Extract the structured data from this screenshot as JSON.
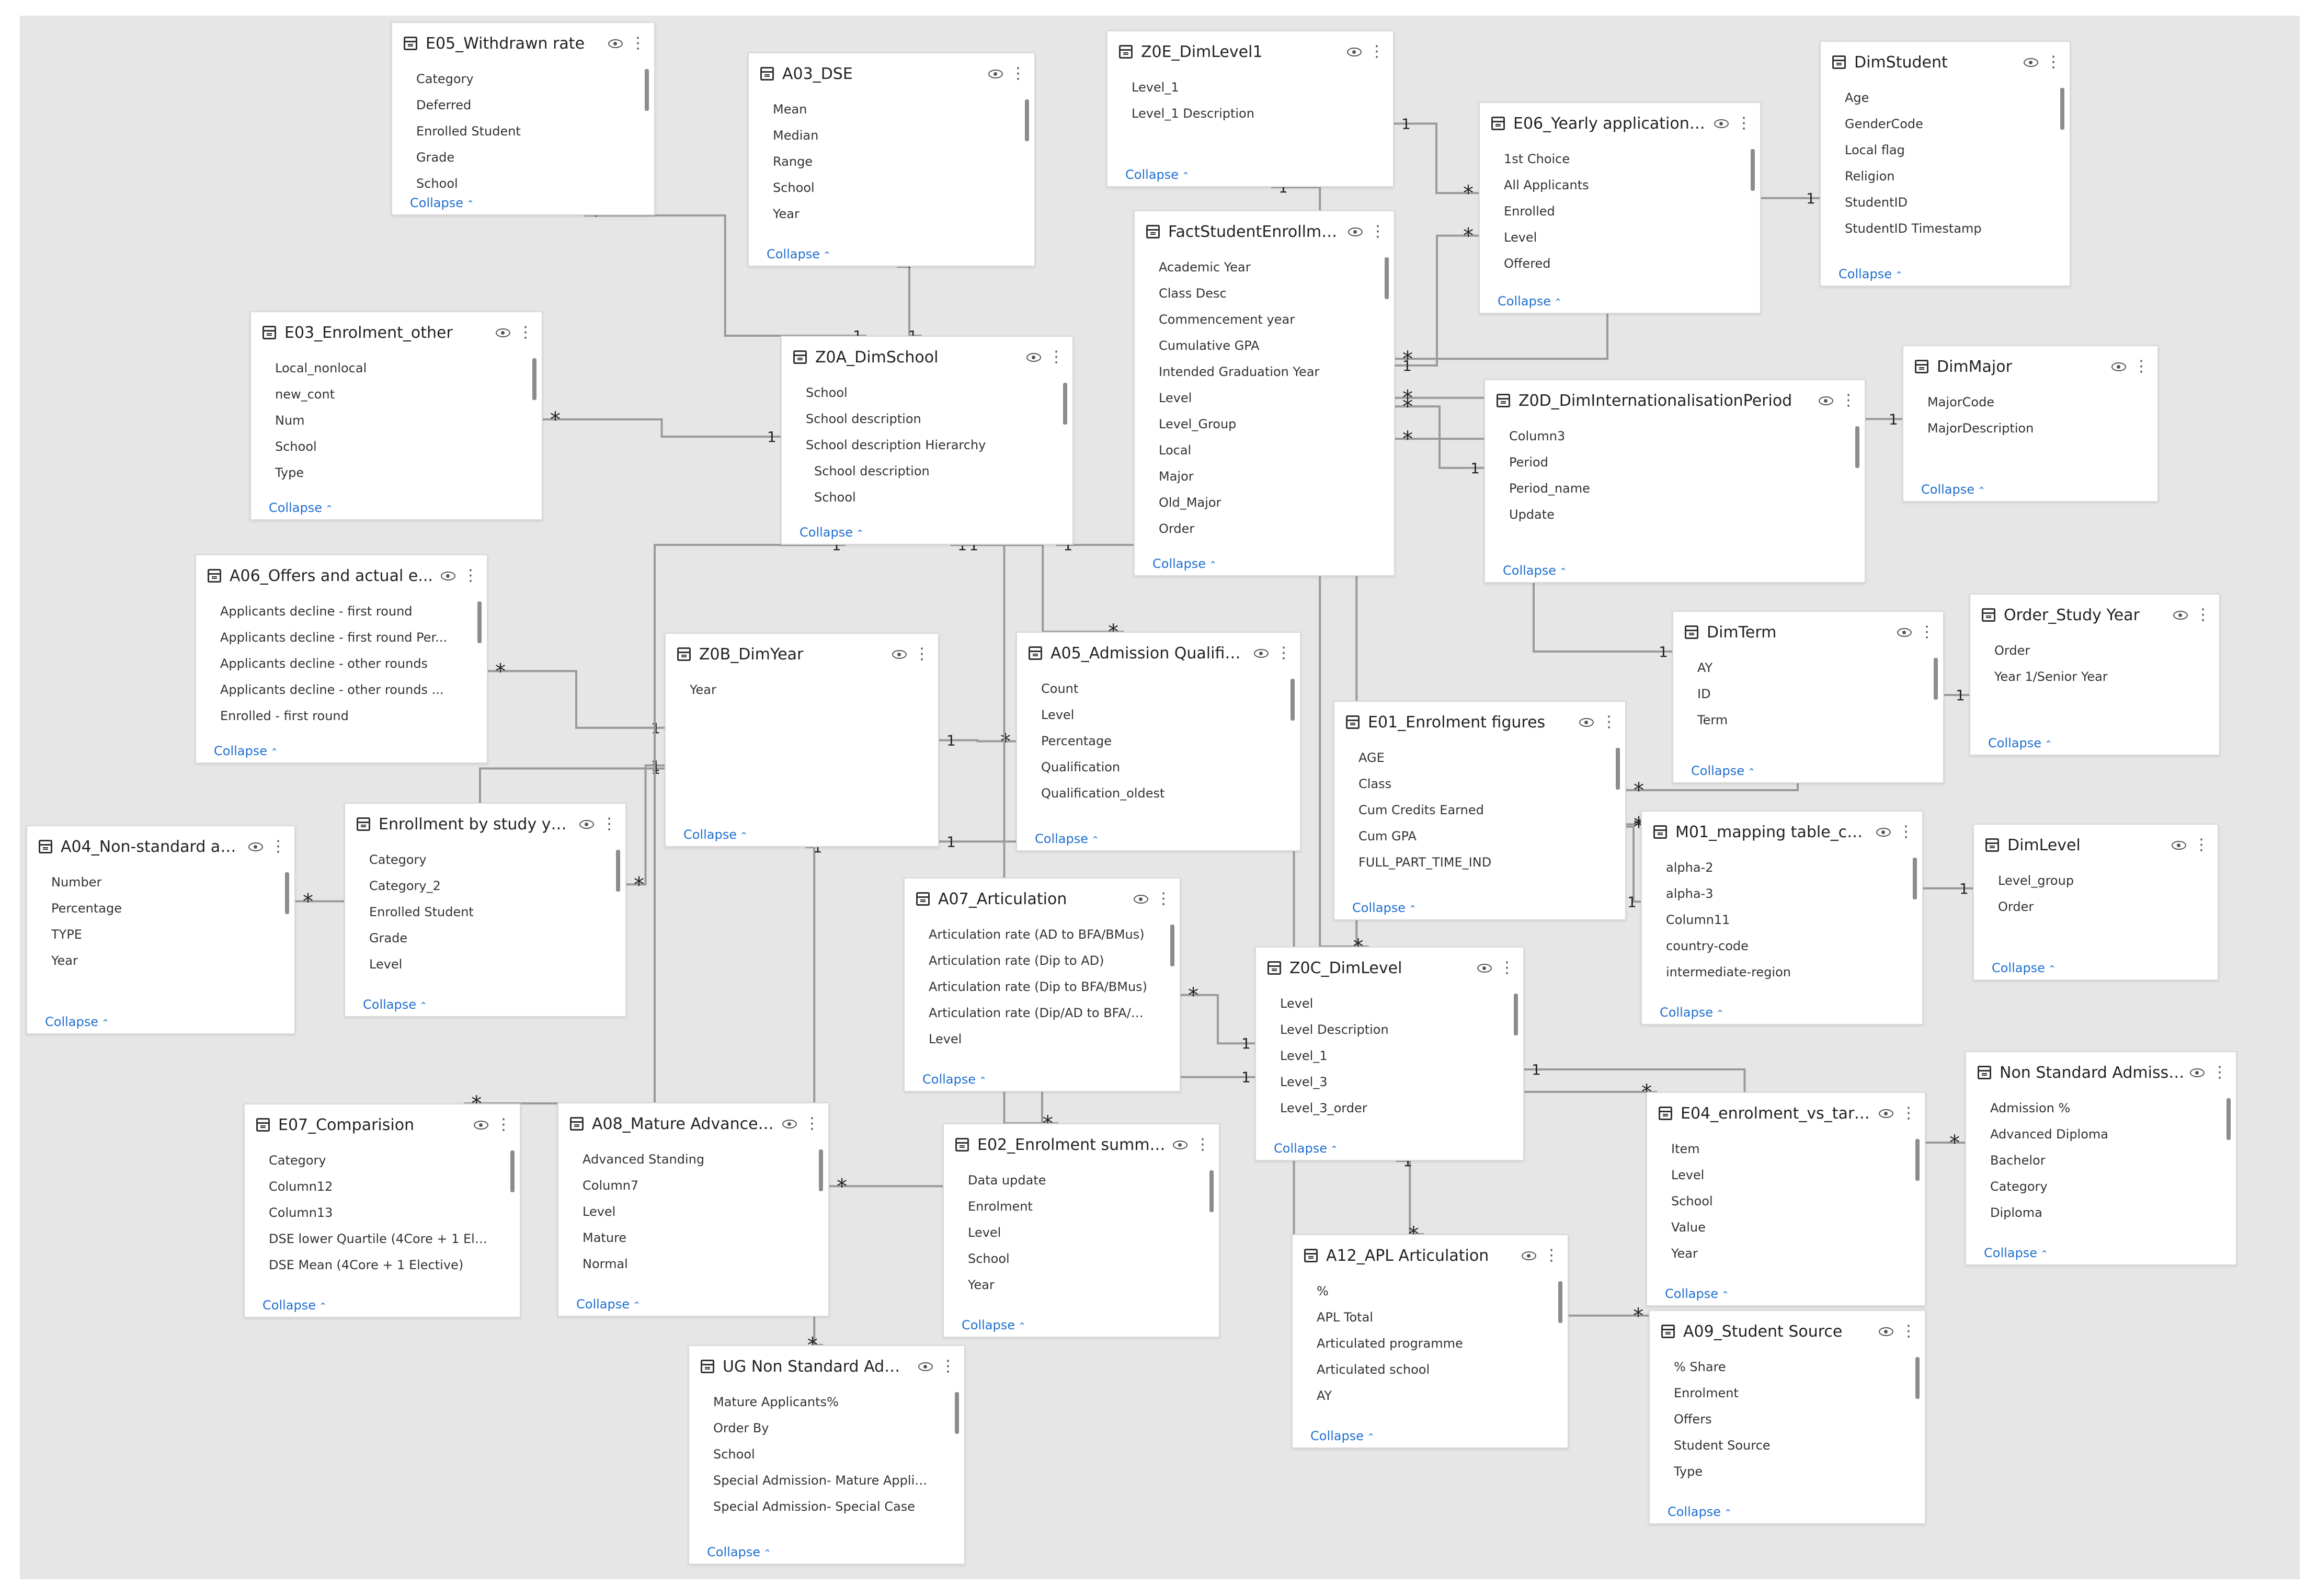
{
  "diagram": {
    "collapse_label": "Collapse",
    "many": "*",
    "one": "1",
    "tables": [
      {
        "id": "e05",
        "title": "E05_Withdrawn rate",
        "fields": [
          {
            "label": "Category",
            "icon": ""
          },
          {
            "label": "Deferred",
            "icon": "sigma"
          },
          {
            "label": "Enrolled Student",
            "icon": "sigma"
          },
          {
            "label": "Grade",
            "icon": ""
          },
          {
            "label": "School",
            "icon": ""
          }
        ]
      },
      {
        "id": "a03",
        "title": "A03_DSE",
        "fields": [
          {
            "label": "Mean",
            "icon": "sigma"
          },
          {
            "label": "Median",
            "icon": ""
          },
          {
            "label": "Range",
            "icon": ""
          },
          {
            "label": "School",
            "icon": ""
          },
          {
            "label": "Year",
            "icon": ""
          }
        ]
      },
      {
        "id": "z0e",
        "title": "Z0E_DimLevel1",
        "fields": [
          {
            "label": "Level_1",
            "icon": ""
          },
          {
            "label": "Level_1 Description",
            "icon": ""
          }
        ]
      },
      {
        "id": "e06",
        "title": "E06_Yearly applications ...",
        "fields": [
          {
            "label": "1st Choice",
            "icon": "sigma"
          },
          {
            "label": "All Applicants",
            "icon": "sigma"
          },
          {
            "label": "Enrolled",
            "icon": "sigma"
          },
          {
            "label": "Level",
            "icon": ""
          },
          {
            "label": "Offered",
            "icon": "sigma"
          }
        ]
      },
      {
        "id": "dimstudent",
        "title": "DimStudent",
        "fields": [
          {
            "label": "Age",
            "icon": "sigma"
          },
          {
            "label": "GenderCode",
            "icon": ""
          },
          {
            "label": "Local flag",
            "icon": ""
          },
          {
            "label": "Religion",
            "icon": ""
          },
          {
            "label": "StudentID",
            "icon": ""
          },
          {
            "label": "StudentID Timestamp",
            "icon": "calendar"
          }
        ]
      },
      {
        "id": "fact",
        "title": "FactStudentEnrollment",
        "fields": [
          {
            "label": "Academic Year",
            "icon": "calendar"
          },
          {
            "label": "Class Desc",
            "icon": ""
          },
          {
            "label": "Commencement year",
            "icon": "sigma"
          },
          {
            "label": "Cumulative GPA",
            "icon": "sigma"
          },
          {
            "label": "Intended Graduation Year",
            "icon": "sigma"
          },
          {
            "label": "Level",
            "icon": ""
          },
          {
            "label": "Level_Group",
            "icon": ""
          },
          {
            "label": "Local",
            "icon": "calendar"
          },
          {
            "label": "Major",
            "icon": ""
          },
          {
            "label": "Old_Major",
            "icon": ""
          },
          {
            "label": "Order",
            "icon": "calendar"
          }
        ]
      },
      {
        "id": "e03",
        "title": "E03_Enrolment_other",
        "fields": [
          {
            "label": "Local_nonlocal",
            "icon": ""
          },
          {
            "label": "new_cont",
            "icon": ""
          },
          {
            "label": "Num",
            "icon": "sigma"
          },
          {
            "label": "School",
            "icon": ""
          },
          {
            "label": "Type",
            "icon": ""
          }
        ]
      },
      {
        "id": "z0a",
        "title": "Z0A_DimSchool",
        "fields": [
          {
            "label": "School",
            "icon": ""
          },
          {
            "label": "School description",
            "icon": ""
          },
          {
            "label": "School description Hierarchy",
            "icon": "hierarchy"
          },
          {
            "label": "School description",
            "icon": "",
            "indent": true
          },
          {
            "label": "School",
            "icon": "",
            "indent": true
          }
        ]
      },
      {
        "id": "z0d",
        "title": "Z0D_DimInternationalisationPeriod",
        "fields": [
          {
            "label": "Column3",
            "icon": ""
          },
          {
            "label": "Period",
            "icon": "sigma"
          },
          {
            "label": "Period_name",
            "icon": ""
          },
          {
            "label": "Update",
            "icon": ""
          }
        ]
      },
      {
        "id": "dimmajor",
        "title": "DimMajor",
        "fields": [
          {
            "label": "MajorCode",
            "icon": ""
          },
          {
            "label": "MajorDescription",
            "icon": ""
          }
        ]
      },
      {
        "id": "a06",
        "title": "A06_Offers and actual e...",
        "fields": [
          {
            "label": "Applicants decline - first round",
            "icon": "sigma"
          },
          {
            "label": "Applicants decline - first round Per...",
            "icon": "sigma"
          },
          {
            "label": "Applicants decline - other rounds",
            "icon": "sigma"
          },
          {
            "label": "Applicants decline - other rounds ...",
            "icon": ""
          },
          {
            "label": "Enrolled - first round",
            "icon": "sigma"
          }
        ]
      },
      {
        "id": "z0b",
        "title": "Z0B_DimYear",
        "fields": [
          {
            "label": "Year",
            "icon": ""
          }
        ]
      },
      {
        "id": "a05",
        "title": "A05_Admission Qualifica...",
        "fields": [
          {
            "label": "Count",
            "icon": "sigma"
          },
          {
            "label": "Level",
            "icon": ""
          },
          {
            "label": "Percentage",
            "icon": "sigma"
          },
          {
            "label": "Qualification",
            "icon": ""
          },
          {
            "label": "Qualification_oldest",
            "icon": ""
          }
        ]
      },
      {
        "id": "dimterm",
        "title": "DimTerm",
        "fields": [
          {
            "label": "AY",
            "icon": ""
          },
          {
            "label": "ID",
            "icon": ""
          },
          {
            "label": "Term",
            "icon": ""
          }
        ]
      },
      {
        "id": "orderstudy",
        "title": "Order_Study Year",
        "fields": [
          {
            "label": "Order",
            "icon": ""
          },
          {
            "label": "Year 1/Senior Year",
            "icon": ""
          }
        ]
      },
      {
        "id": "e01",
        "title": "E01_Enrolment figures",
        "fields": [
          {
            "label": "AGE",
            "icon": "sigma"
          },
          {
            "label": "Class",
            "icon": ""
          },
          {
            "label": "Cum Credits Earned",
            "icon": "sigma"
          },
          {
            "label": "Cum GPA",
            "icon": ""
          },
          {
            "label": "FULL_PART_TIME_IND",
            "icon": ""
          }
        ]
      },
      {
        "id": "a04",
        "title": "A04_Non-standard admi...",
        "fields": [
          {
            "label": "Number",
            "icon": "sigma"
          },
          {
            "label": "Percentage",
            "icon": "sigma"
          },
          {
            "label": "TYPE",
            "icon": ""
          },
          {
            "label": "Year",
            "icon": ""
          }
        ]
      },
      {
        "id": "ebsy",
        "title": "Enrollment by study year",
        "fields": [
          {
            "label": "Category",
            "icon": ""
          },
          {
            "label": "Category_2",
            "icon": ""
          },
          {
            "label": "Enrolled Student",
            "icon": "sigma"
          },
          {
            "label": "Grade",
            "icon": ""
          },
          {
            "label": "Level",
            "icon": ""
          }
        ]
      },
      {
        "id": "m01",
        "title": "M01_mapping table_cou...",
        "fields": [
          {
            "label": "alpha-2",
            "icon": ""
          },
          {
            "label": "alpha-3",
            "icon": ""
          },
          {
            "label": "Column11",
            "icon": "sigma"
          },
          {
            "label": "country-code",
            "icon": ""
          },
          {
            "label": "intermediate-region",
            "icon": ""
          }
        ]
      },
      {
        "id": "dimlevel",
        "title": "DimLevel",
        "fields": [
          {
            "label": "Level_group",
            "icon": ""
          },
          {
            "label": "Order",
            "icon": ""
          }
        ]
      },
      {
        "id": "a07",
        "title": "A07_Articulation",
        "fields": [
          {
            "label": "Articulation rate (AD to BFA/BMus)",
            "icon": "sigma"
          },
          {
            "label": "Articulation rate (Dip to AD)",
            "icon": "sigma"
          },
          {
            "label": "Articulation rate (Dip to BFA/BMus)",
            "icon": "sigma"
          },
          {
            "label": "Articulation rate (Dip/AD to BFA/B...",
            "icon": "sigma"
          },
          {
            "label": "Level",
            "icon": ""
          }
        ]
      },
      {
        "id": "z0c",
        "title": "Z0C_DimLevel",
        "fields": [
          {
            "label": "Level",
            "icon": ""
          },
          {
            "label": "Level Description",
            "icon": ""
          },
          {
            "label": "Level_1",
            "icon": ""
          },
          {
            "label": "Level_3",
            "icon": ""
          },
          {
            "label": "Level_3_order",
            "icon": ""
          }
        ]
      },
      {
        "id": "nsa",
        "title": "Non Standard Admission",
        "fields": [
          {
            "label": "Admission %",
            "icon": "sigma"
          },
          {
            "label": "Advanced Diploma",
            "icon": "sigma"
          },
          {
            "label": "Bachelor",
            "icon": "sigma"
          },
          {
            "label": "Category",
            "icon": ""
          },
          {
            "label": "Diploma",
            "icon": "sigma"
          }
        ]
      },
      {
        "id": "e07",
        "title": "E07_Comparision",
        "fields": [
          {
            "label": "Category",
            "icon": ""
          },
          {
            "label": "Column12",
            "icon": ""
          },
          {
            "label": "Column13",
            "icon": ""
          },
          {
            "label": "DSE lower Quartile (4Core + 1 Elec...",
            "icon": "sigma"
          },
          {
            "label": "DSE Mean (4Core + 1 Elective)",
            "icon": "sigma"
          }
        ]
      },
      {
        "id": "a08",
        "title": "A08_Mature Advance Sta...",
        "fields": [
          {
            "label": "Advanced Standing",
            "icon": "sigma"
          },
          {
            "label": "Column7",
            "icon": ""
          },
          {
            "label": "Level",
            "icon": ""
          },
          {
            "label": "Mature",
            "icon": "sigma"
          },
          {
            "label": "Normal",
            "icon": "sigma"
          }
        ]
      },
      {
        "id": "e02",
        "title": "E02_Enrolment summary...",
        "fields": [
          {
            "label": "Data update",
            "icon": "calendar"
          },
          {
            "label": "Enrolment",
            "icon": "sigma"
          },
          {
            "label": "Level",
            "icon": ""
          },
          {
            "label": "School",
            "icon": ""
          },
          {
            "label": "Year",
            "icon": ""
          }
        ]
      },
      {
        "id": "e04",
        "title": "E04_enrolment_vs_target",
        "fields": [
          {
            "label": "Item",
            "icon": ""
          },
          {
            "label": "Level",
            "icon": ""
          },
          {
            "label": "School",
            "icon": ""
          },
          {
            "label": "Value",
            "icon": "sigma"
          },
          {
            "label": "Year",
            "icon": ""
          }
        ]
      },
      {
        "id": "a12",
        "title": "A12_APL Articulation",
        "fields": [
          {
            "label": "%",
            "icon": "sigma"
          },
          {
            "label": "APL Total",
            "icon": "sigma"
          },
          {
            "label": "Articulated programme",
            "icon": ""
          },
          {
            "label": "Articulated school",
            "icon": ""
          },
          {
            "label": "AY",
            "icon": ""
          }
        ]
      },
      {
        "id": "a09",
        "title": "A09_Student Source",
        "fields": [
          {
            "label": "% Share",
            "icon": "sigma"
          },
          {
            "label": "Enrolment",
            "icon": "sigma"
          },
          {
            "label": "Offers",
            "icon": "sigma"
          },
          {
            "label": "Student Source",
            "icon": ""
          },
          {
            "label": "Type",
            "icon": ""
          }
        ]
      },
      {
        "id": "ugnsa",
        "title": "UG Non Standard Admis...",
        "fields": [
          {
            "label": "Mature Applicants%",
            "icon": "sigma"
          },
          {
            "label": "Order By",
            "icon": "sigma"
          },
          {
            "label": "School",
            "icon": ""
          },
          {
            "label": "Special Admission- Mature Applica...",
            "icon": "sigma"
          },
          {
            "label": "Special Admission- Special Case",
            "icon": "sigma"
          }
        ]
      }
    ]
  }
}
